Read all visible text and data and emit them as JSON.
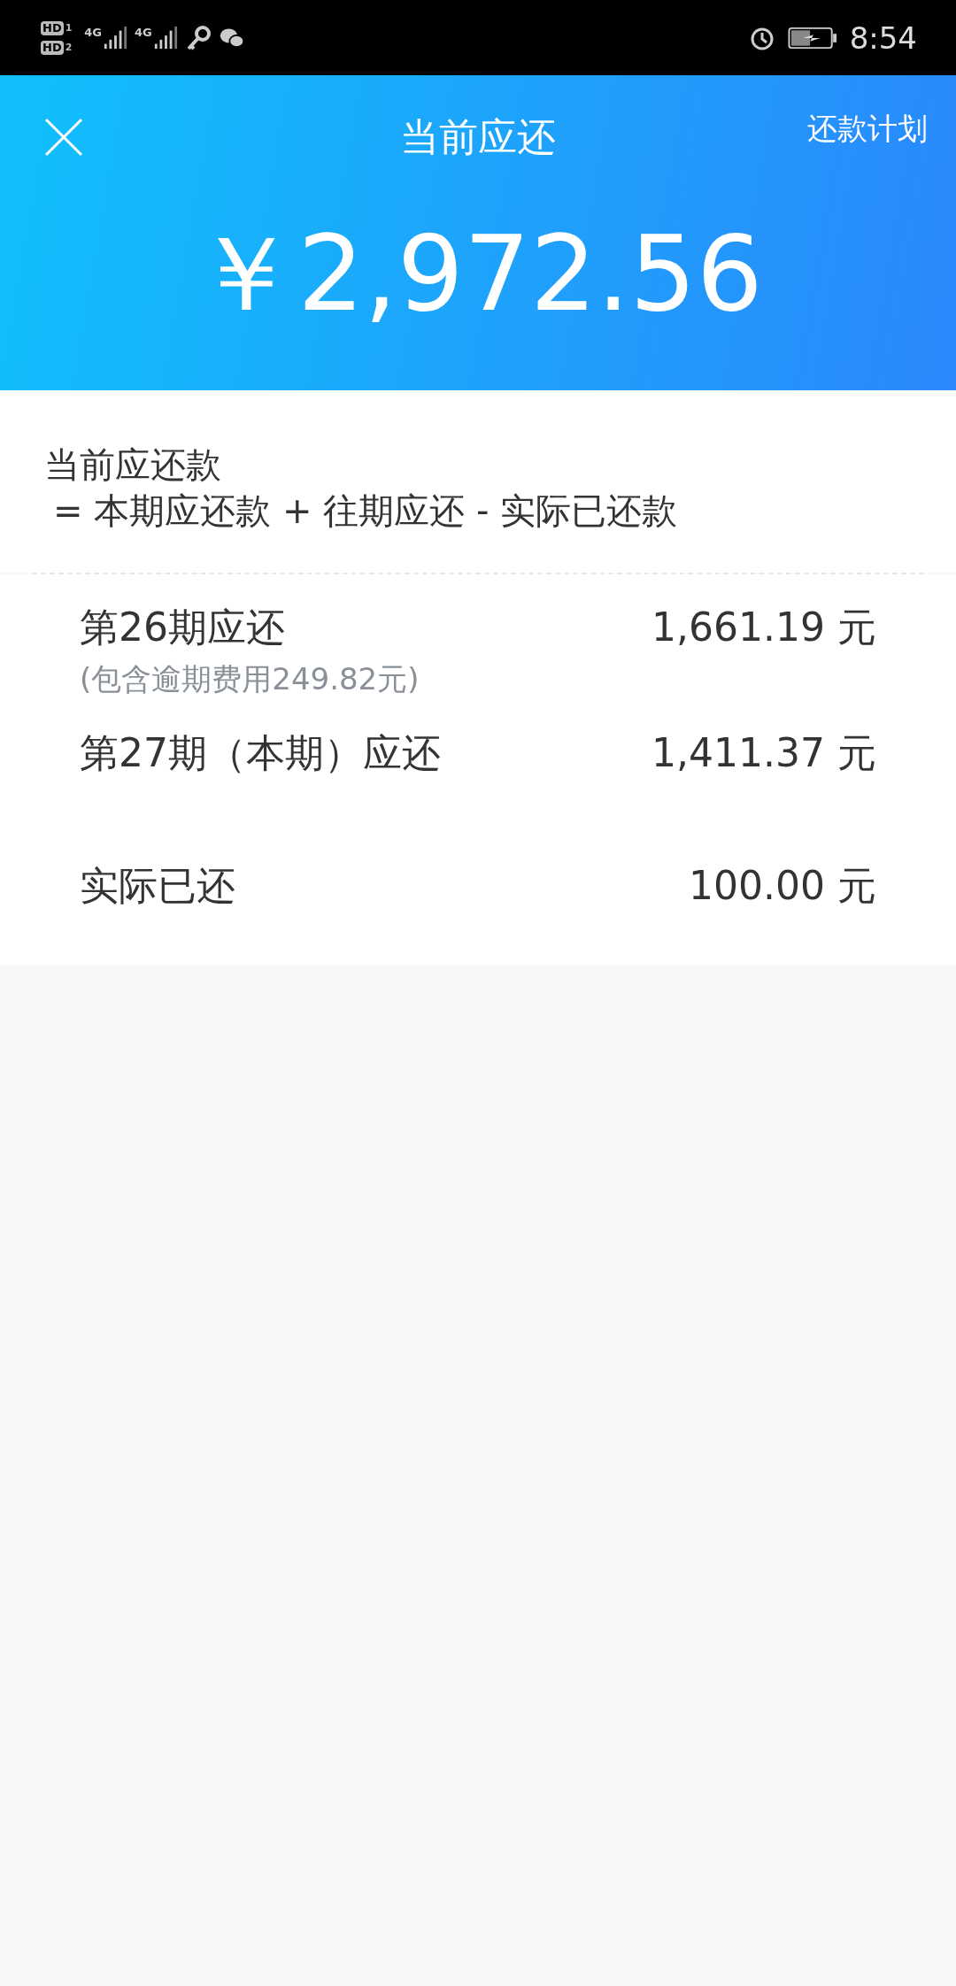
{
  "status_bar": {
    "sims": [
      {
        "badge": "HD",
        "slot": "1"
      },
      {
        "badge": "HD",
        "slot": "2"
      }
    ],
    "networks": [
      "4G",
      "4G"
    ],
    "time": "8:54"
  },
  "header": {
    "title": "当前应还",
    "action": "还款计划",
    "amount": "￥2,972.56"
  },
  "formula": {
    "title": "当前应还款",
    "expression": "= 本期应还款 + 往期应还 - 实际已还款"
  },
  "rows": [
    {
      "kind": "due",
      "label": "第26期应还",
      "amount": "1,661.19 元",
      "note": "(包含逾期费用249.82元)"
    },
    {
      "kind": "due",
      "label": "第27期（本期）应还",
      "amount": "1,411.37 元"
    },
    {
      "kind": "paid",
      "label": "实际已还",
      "amount": "100.00 元"
    }
  ]
}
